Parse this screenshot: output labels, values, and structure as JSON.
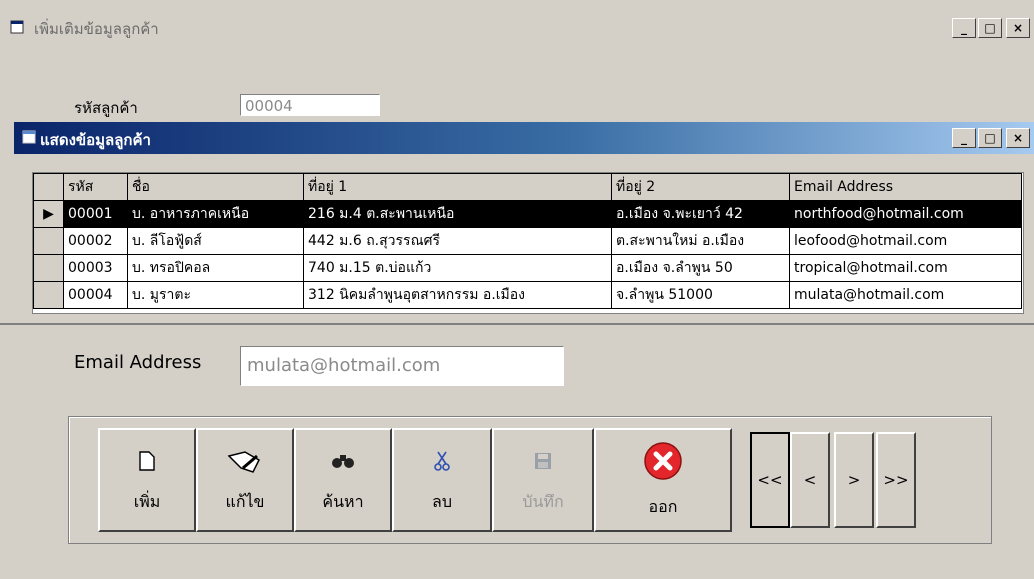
{
  "window": {
    "title": "เพิ่มเติมข้อมูลลูกค้า",
    "minimize": "_",
    "maximize": "□",
    "close": "×"
  },
  "form": {
    "code_label": "รหัสลูกค้า",
    "code_value": "00004",
    "email_label": "Email Address",
    "email_value": "mulata@hotmail.com"
  },
  "grid_window": {
    "title": "แสดงข้อมูลลูกค้า"
  },
  "grid": {
    "headers": [
      "รหัส",
      "ชื่อ",
      "ที่อยู่ 1",
      "ที่อยู่ 2",
      "Email Address"
    ],
    "rows": [
      [
        "00001",
        "บ. อาหารภาคเหนือ",
        "216 ม.4 ต.สะพานเหนือ",
        "อ.เมือง จ.พะเยาว์ 42",
        "northfood@hotmail.com"
      ],
      [
        "00002",
        "บ. ลีโอฟู้ดส์",
        "442 ม.6 ถ.สุวรรณศรี",
        "ต.สะพานใหม่ อ.เมือง",
        "leofood@hotmail.com"
      ],
      [
        "00003",
        "บ. ทรอปิคอล",
        "740 ม.15 ต.บ่อแก้ว",
        "อ.เมือง จ.ลำพูน 50",
        "tropical@hotmail.com"
      ],
      [
        "00004",
        "บ. มูราตะ",
        "312 นิคมลำพูนอุตสาหกรรม อ.เมือง",
        "จ.ลำพูน 51000",
        "mulata@hotmail.com"
      ]
    ],
    "current_marker": "▶"
  },
  "toolbar": {
    "add": "เพิ่ม",
    "edit": "แก้ไข",
    "search": "ค้นหา",
    "delete": "ลบ",
    "save": "บันทึก",
    "exit": "ออก",
    "first": "<<",
    "prev": "<",
    "next": ">",
    "last": ">>"
  },
  "colors": {
    "titlebar_active": "#0a246a",
    "selected_row": "#000000",
    "exit_icon": "#e3262b"
  }
}
